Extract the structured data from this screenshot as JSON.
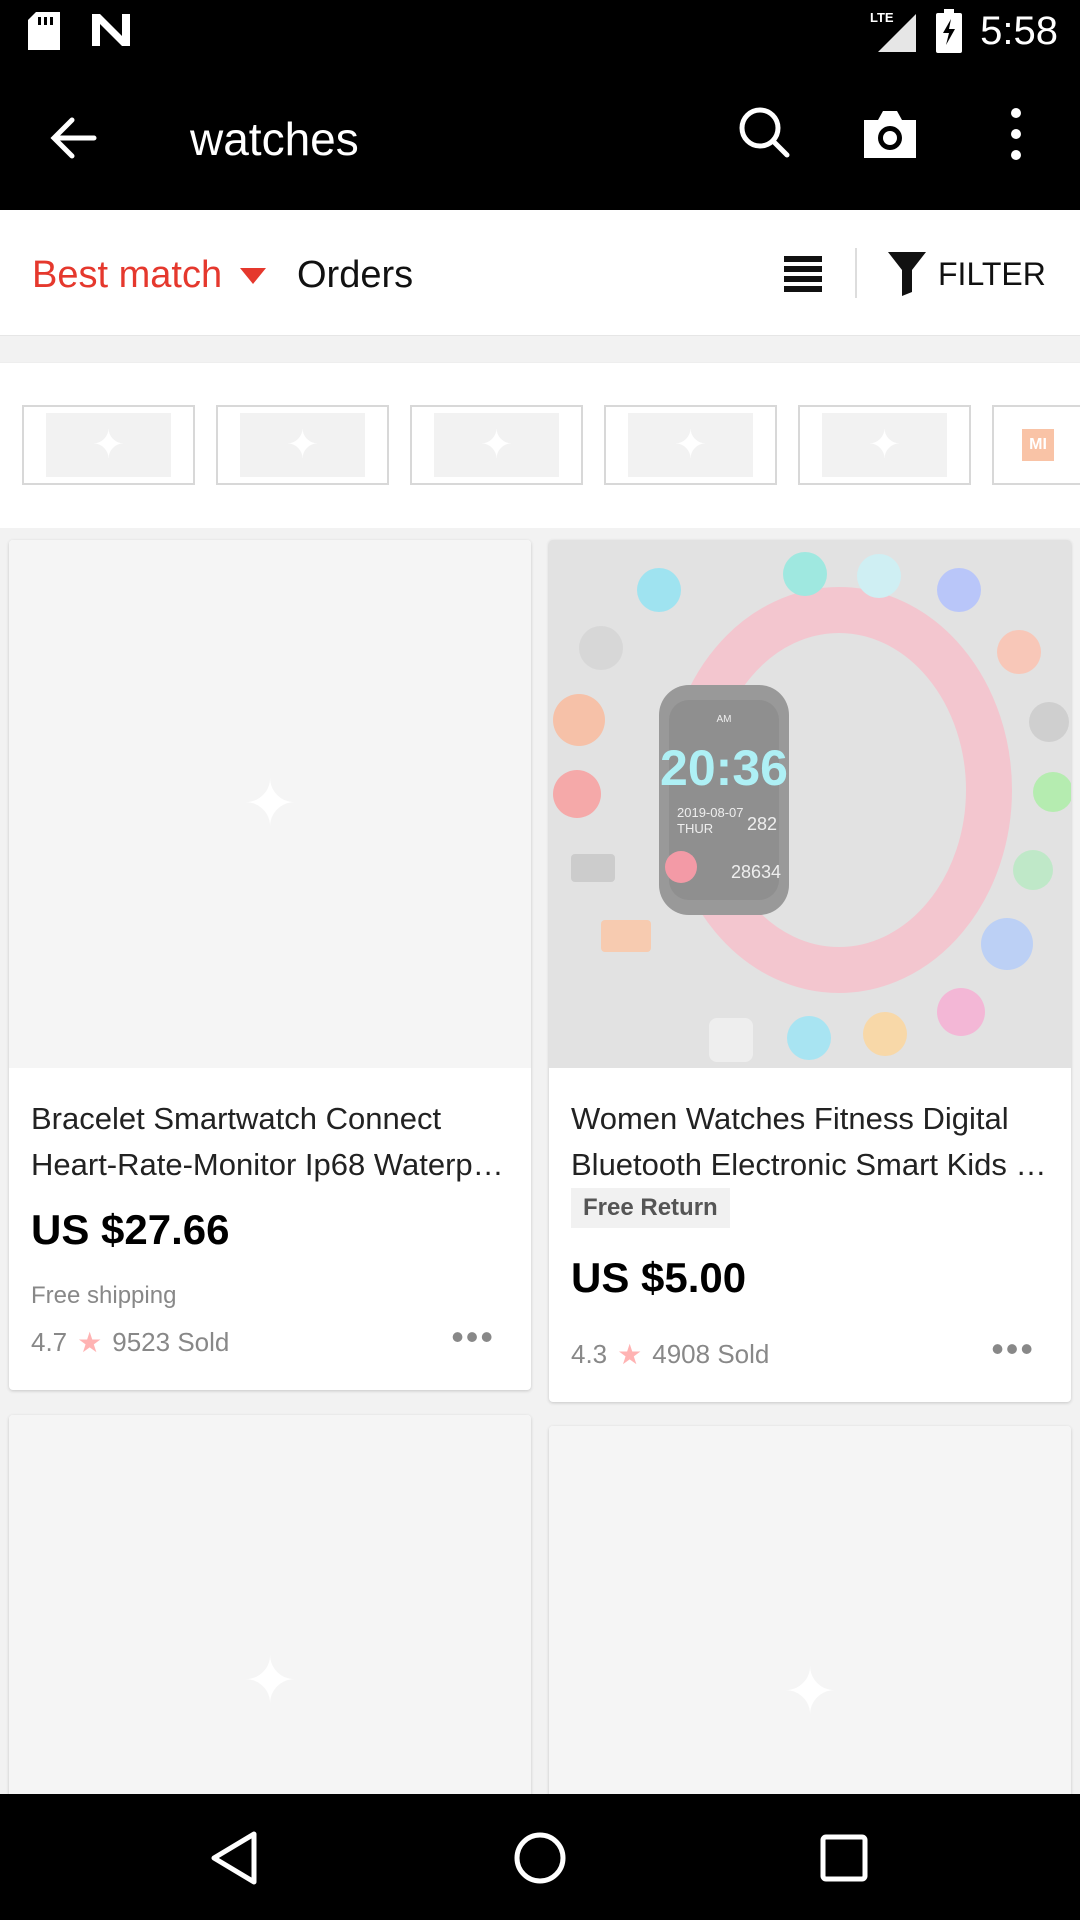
{
  "status_bar": {
    "time": "5:58",
    "network": "LTE"
  },
  "app_bar": {
    "title": "watches"
  },
  "sort_bar": {
    "best_match": "Best match",
    "orders": "Orders",
    "filter": "FILTER"
  },
  "brand_strip": {
    "last_brand": "MI"
  },
  "products": [
    {
      "title_line1": "Bracelet Smartwatch Connect",
      "title_line2": "Heart-Rate-Monitor Ip68 Waterpr…",
      "price": "US $27.66",
      "shipping": "Free shipping",
      "rating": "4.7",
      "sold": "9523 Sold"
    },
    {
      "title_line1": "Women Watches Fitness Digital",
      "title_line2": "Bluetooth Electronic Smart Kids …",
      "badge": "Free Return",
      "price": "US $5.00",
      "rating": "4.3",
      "sold": "4908 Sold",
      "watch_time": "20:36",
      "watch_date": "2019-08-07",
      "watch_day": "THUR",
      "watch_heart": "282",
      "watch_steps": "28634",
      "watch_am": "AM"
    }
  ],
  "colors": {
    "accent": "#e5382d",
    "bar": "#000000"
  }
}
